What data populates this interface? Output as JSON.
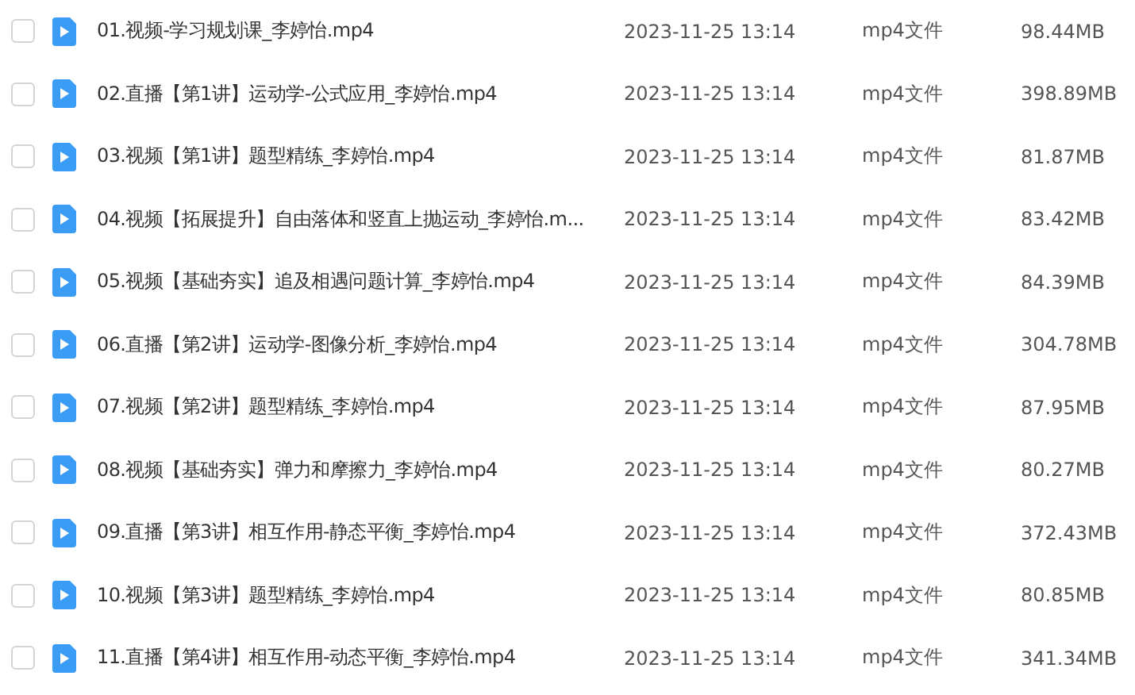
{
  "files": [
    {
      "name": "01.视频-学习规划课_李婷怡.mp4",
      "date": "2023-11-25 13:14",
      "type": "mp4文件",
      "size": "98.44MB",
      "checked": false
    },
    {
      "name": "02.直播【第1讲】运动学-公式应用_李婷怡.mp4",
      "date": "2023-11-25 13:14",
      "type": "mp4文件",
      "size": "398.89MB",
      "checked": false
    },
    {
      "name": "03.视频【第1讲】题型精练_李婷怡.mp4",
      "date": "2023-11-25 13:14",
      "type": "mp4文件",
      "size": "81.87MB",
      "checked": false
    },
    {
      "name": "04.视频【拓展提升】自由落体和竖直上抛运动_李婷怡.m...",
      "date": "2023-11-25 13:14",
      "type": "mp4文件",
      "size": "83.42MB",
      "checked": false
    },
    {
      "name": "05.视频【基础夯实】追及相遇问题计算_李婷怡.mp4",
      "date": "2023-11-25 13:14",
      "type": "mp4文件",
      "size": "84.39MB",
      "checked": false
    },
    {
      "name": "06.直播【第2讲】运动学-图像分析_李婷怡.mp4",
      "date": "2023-11-25 13:14",
      "type": "mp4文件",
      "size": "304.78MB",
      "checked": false
    },
    {
      "name": "07.视频【第2讲】题型精练_李婷怡.mp4",
      "date": "2023-11-25 13:14",
      "type": "mp4文件",
      "size": "87.95MB",
      "checked": false
    },
    {
      "name": "08.视频【基础夯实】弹力和摩擦力_李婷怡.mp4",
      "date": "2023-11-25 13:14",
      "type": "mp4文件",
      "size": "80.27MB",
      "checked": false
    },
    {
      "name": "09.直播【第3讲】相互作用-静态平衡_李婷怡.mp4",
      "date": "2023-11-25 13:14",
      "type": "mp4文件",
      "size": "372.43MB",
      "checked": false
    },
    {
      "name": "10.视频【第3讲】题型精练_李婷怡.mp4",
      "date": "2023-11-25 13:14",
      "type": "mp4文件",
      "size": "80.85MB",
      "checked": false
    },
    {
      "name": "11.直播【第4讲】相互作用-动态平衡_李婷怡.mp4",
      "date": "2023-11-25 13:14",
      "type": "mp4文件",
      "size": "341.34MB",
      "checked": false
    }
  ]
}
